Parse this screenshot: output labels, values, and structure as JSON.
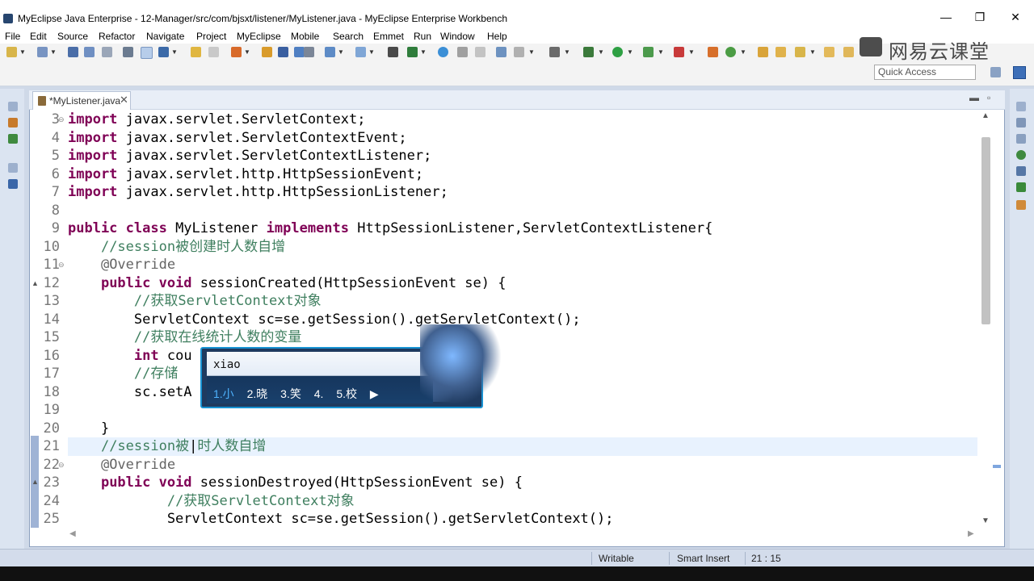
{
  "window": {
    "title": "MyEclipse Java Enterprise - 12-Manager/src/com/bjsxt/listener/MyListener.java - MyEclipse Enterprise Workbench",
    "controls": [
      "—",
      "❐",
      "✕"
    ]
  },
  "menu": [
    "File",
    "Edit",
    "Source",
    "Refactor",
    "Navigate",
    "Project",
    "MyEclipse",
    "Mobile",
    "Search",
    "Emmet",
    "Run",
    "Window",
    "Help"
  ],
  "watermark": "网易云课堂",
  "quick_access": {
    "placeholder": "Quick Access"
  },
  "editor": {
    "tab_label": "*MyListener.java",
    "tab_close": "✕",
    "pane_min": "▬",
    "pane_max": "▫"
  },
  "code_lines": [
    {
      "n": "3",
      "parts": [
        [
          "kw",
          "import"
        ],
        [
          "p",
          " javax.servlet.ServletContext;"
        ]
      ]
    },
    {
      "n": "4",
      "parts": [
        [
          "kw",
          "import"
        ],
        [
          "p",
          " javax.servlet.ServletContextEvent;"
        ]
      ]
    },
    {
      "n": "5",
      "parts": [
        [
          "kw",
          "import"
        ],
        [
          "p",
          " javax.servlet.ServletContextListener;"
        ]
      ]
    },
    {
      "n": "6",
      "parts": [
        [
          "kw",
          "import"
        ],
        [
          "p",
          " javax.servlet.http.HttpSessionEvent;"
        ]
      ]
    },
    {
      "n": "7",
      "parts": [
        [
          "kw",
          "import"
        ],
        [
          "p",
          " javax.servlet.http.HttpSessionListener;"
        ]
      ]
    },
    {
      "n": "8",
      "parts": []
    },
    {
      "n": "9",
      "parts": [
        [
          "kw",
          "public class"
        ],
        [
          "p",
          " MyListener "
        ],
        [
          "kw",
          "implements"
        ],
        [
          "p",
          " HttpSessionListener,ServletContextListener{"
        ]
      ]
    },
    {
      "n": "10",
      "parts": [
        [
          "p",
          "    "
        ],
        [
          "cm",
          "//session被创建时人数自增"
        ]
      ]
    },
    {
      "n": "11",
      "parts": [
        [
          "p",
          "    "
        ],
        [
          "an",
          "@Override"
        ]
      ]
    },
    {
      "n": "12",
      "parts": [
        [
          "p",
          "    "
        ],
        [
          "kw",
          "public void"
        ],
        [
          "p",
          " sessionCreated(HttpSessionEvent se) {"
        ]
      ]
    },
    {
      "n": "13",
      "parts": [
        [
          "p",
          "        "
        ],
        [
          "cm",
          "//获取ServletContext对象"
        ]
      ]
    },
    {
      "n": "14",
      "parts": [
        [
          "p",
          "        ServletContext sc=se.getSession().getServletContext();"
        ]
      ]
    },
    {
      "n": "15",
      "parts": [
        [
          "p",
          "        "
        ],
        [
          "cm",
          "//获取在线统计人数的变量"
        ]
      ]
    },
    {
      "n": "16",
      "parts": [
        [
          "p",
          "        "
        ],
        [
          "kw",
          "int"
        ],
        [
          "p",
          " cou                          \");"
        ]
      ]
    },
    {
      "n": "17",
      "parts": [
        [
          "p",
          "        "
        ],
        [
          "cm",
          "//存储"
        ]
      ]
    },
    {
      "n": "18",
      "parts": [
        [
          "p",
          "        sc.setA"
        ]
      ]
    },
    {
      "n": "19",
      "parts": []
    },
    {
      "n": "20",
      "parts": [
        [
          "p",
          "    }"
        ]
      ]
    },
    {
      "n": "21",
      "parts": [
        [
          "p",
          "    "
        ],
        [
          "cm",
          "//session被"
        ],
        [
          "p",
          "|"
        ],
        [
          "cm",
          "时人数自增"
        ]
      ]
    },
    {
      "n": "22",
      "parts": [
        [
          "p",
          "    "
        ],
        [
          "an",
          "@Override"
        ]
      ]
    },
    {
      "n": "23",
      "parts": [
        [
          "p",
          "    "
        ],
        [
          "kw",
          "public void"
        ],
        [
          "p",
          " sessionDestroyed(HttpSessionEvent se) {"
        ]
      ]
    },
    {
      "n": "24",
      "parts": [
        [
          "p",
          "            "
        ],
        [
          "cm",
          "//获取ServletContext对象"
        ]
      ]
    },
    {
      "n": "25",
      "parts": [
        [
          "p",
          "            ServletContext sc=se.getSession().getServletContext();"
        ]
      ]
    }
  ],
  "ime": {
    "input": "xiao",
    "candidates": [
      "1.小",
      "2.晓",
      "3.笑",
      "4.",
      "5.校",
      "▶"
    ]
  },
  "status": {
    "writable": "Writable",
    "insert_mode": "Smart Insert",
    "position": "21 : 15"
  },
  "colors": {
    "keyword": "#7f0055",
    "comment": "#3f7f5f",
    "annotation": "#646464",
    "ime_frame": "#1893d3"
  }
}
